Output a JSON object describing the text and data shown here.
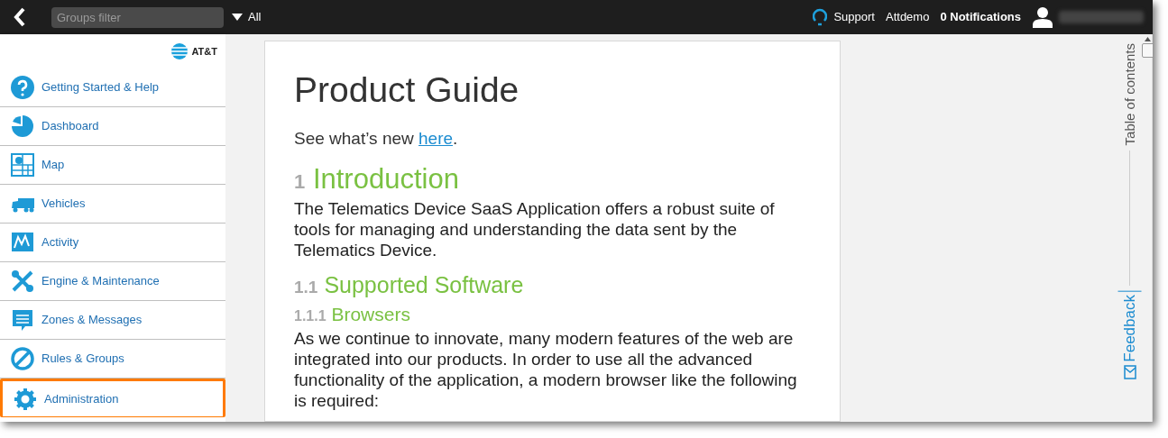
{
  "top_bar": {
    "groups_filter": {
      "placeholder": "Groups filter"
    },
    "scope": "All",
    "support": "Support",
    "account": "Attdemo",
    "notifications": "0 Notifications"
  },
  "sidebar": {
    "logo": "AT&T",
    "items": [
      {
        "label": "Getting Started & Help",
        "highlighted": false
      },
      {
        "label": "Dashboard",
        "highlighted": false
      },
      {
        "label": "Map",
        "highlighted": false
      },
      {
        "label": "Vehicles",
        "highlighted": false
      },
      {
        "label": "Activity",
        "highlighted": false
      },
      {
        "label": "Engine & Maintenance",
        "highlighted": false
      },
      {
        "label": "Zones & Messages",
        "highlighted": false
      },
      {
        "label": "Rules & Groups",
        "highlighted": false
      },
      {
        "label": "Administration",
        "highlighted": true
      }
    ]
  },
  "document": {
    "title": "Product Guide",
    "intro": "See what’s new ",
    "intro_link": "here",
    "intro_end": ".",
    "blocks": [
      {
        "kind": "h1",
        "number": "1",
        "text": "Introduction"
      },
      {
        "kind": "p",
        "text": "The Telematics Device SaaS Application offers a robust suite of tools for managing and understanding the data sent by the Telematics Device."
      },
      {
        "kind": "h2",
        "number": "1.1",
        "text": "Supported Software"
      },
      {
        "kind": "h3",
        "number": "1.1.1",
        "text": "Browsers"
      },
      {
        "kind": "p",
        "text": "As we continue to innovate, many modern features of the web are integrated into our products. In order to use all the advanced functionality of the application, a modern browser like the following is required:"
      }
    ]
  },
  "side_panel": {
    "toc": "Table of contents",
    "feedback": "Feedback"
  }
}
